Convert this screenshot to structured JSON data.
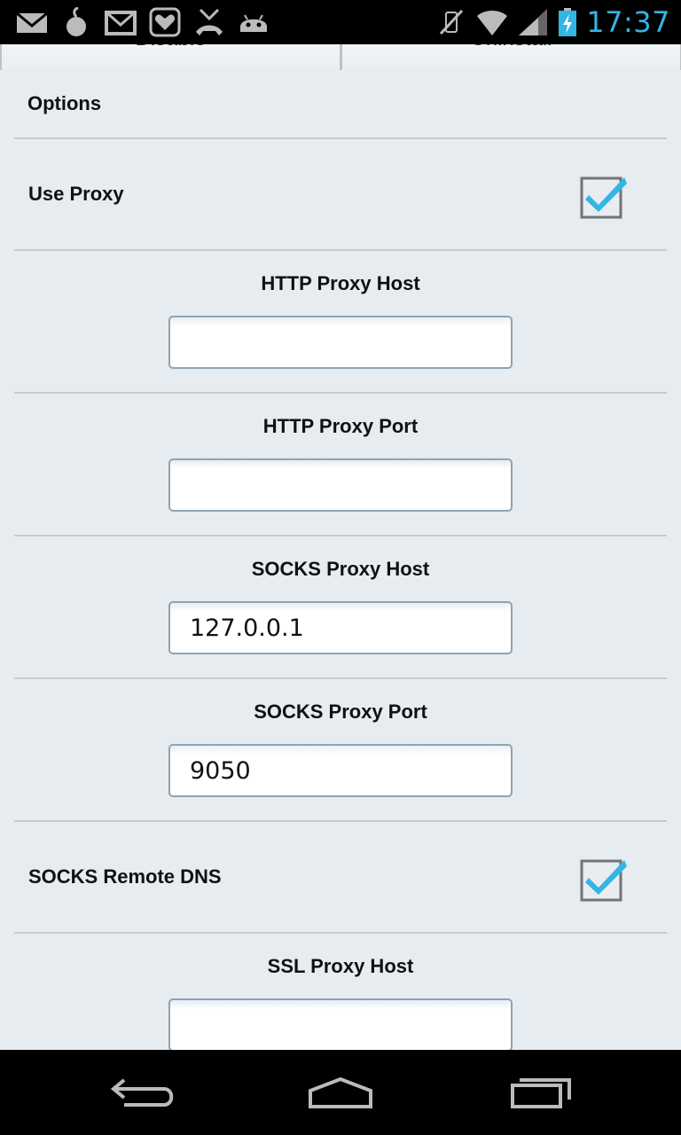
{
  "status_bar": {
    "time": "17:37",
    "left_icons": [
      "gmail-icon",
      "tor-onion-icon",
      "email-icon",
      "heart-app-icon",
      "missed-call-icon",
      "android-debug-icon"
    ],
    "right_icons": [
      "vibrate-mute-icon",
      "wifi-icon",
      "cell-signal-icon",
      "battery-charging-icon"
    ]
  },
  "top_buttons": {
    "left_label": "Disable",
    "right_label": "Uninstall"
  },
  "options": {
    "header": "Options",
    "use_proxy": {
      "label": "Use Proxy",
      "checked": true
    },
    "http_proxy_host": {
      "label": "HTTP Proxy Host",
      "value": ""
    },
    "http_proxy_port": {
      "label": "HTTP Proxy Port",
      "value": ""
    },
    "socks_proxy_host": {
      "label": "SOCKS Proxy Host",
      "value": "127.0.0.1"
    },
    "socks_proxy_port": {
      "label": "SOCKS Proxy Port",
      "value": "9050"
    },
    "socks_remote_dns": {
      "label": "SOCKS Remote DNS",
      "checked": true
    },
    "ssl_proxy_host": {
      "label": "SSL Proxy Host",
      "value": ""
    }
  },
  "nav_bar": {
    "buttons": [
      "back-icon",
      "home-icon",
      "recent-apps-icon"
    ]
  },
  "colors": {
    "accent": "#33b5e5",
    "background": "#e6ecef",
    "divider": "#c6cbce",
    "status_bar": "#000000"
  }
}
